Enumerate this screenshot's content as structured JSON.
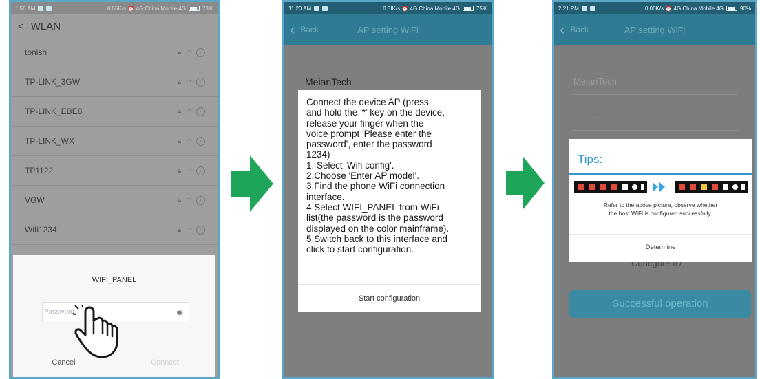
{
  "colors": {
    "accent": "#2e7b93",
    "arrow_green": "#1fa55a",
    "tips_blue": "#3498c8"
  },
  "panel1": {
    "status": {
      "time": "1:56 AM",
      "info": "0.55K/s ⏰ 4G China Mobile 4G",
      "battery": "73%"
    },
    "header": "WLAN",
    "networks": [
      {
        "ssid": "tonish"
      },
      {
        "ssid": "TP-LINK_3GW"
      },
      {
        "ssid": "TP-LINK_EBE8"
      },
      {
        "ssid": "TP-LINK_WX"
      },
      {
        "ssid": "TP1122"
      },
      {
        "ssid": "VGW"
      },
      {
        "ssid": "Wifi1234"
      }
    ],
    "dialog": {
      "title": "WIFI_PANEL",
      "password_placeholder": "Password",
      "cancel": "Cancel",
      "connect": "Connect"
    }
  },
  "panel2": {
    "status": {
      "time": "11:20 AM",
      "info": "0.3IK/s ⏰ 4G China Mobile 4G",
      "battery": "75%"
    },
    "appbar": {
      "back": "Back",
      "title": "AP setting WiFi"
    },
    "ssid": "MeianTech",
    "dialog": {
      "lines": [
        "Connect the device AP (press",
        "and hold the '*' key on the device,",
        "release your finger when the",
        "voice prompt 'Please enter the",
        "password', enter the password",
        "1234)",
        "1. Select 'Wifi config'.",
        "2.Choose 'Enter AP model'.",
        "3.Find the phone WiFi connection",
        "interface.",
        "4.Select WIFI_PANEL from WiFi",
        "list(the password is the password",
        "displayed on the color mainframe).",
        "5.Switch back to this interface and",
        "click to start configuration."
      ],
      "button": "Start configuration"
    }
  },
  "panel3": {
    "status": {
      "time": "2:21 PM",
      "info": "0.00K/s ⏰ 4G China Mobile 4G",
      "battery": "90%"
    },
    "appbar": {
      "back": "Back",
      "title": "AP setting WiFi"
    },
    "ssid": "MeianTech",
    "password_mask": "·········",
    "configure_label": "Configure ID",
    "success_button": "Successful operation",
    "dialog": {
      "title": "Tips:",
      "description_line1": "Refer to the above picture, observe whether",
      "description_line2": "the host WiFi is configured successfully.",
      "button": "Determine"
    }
  }
}
